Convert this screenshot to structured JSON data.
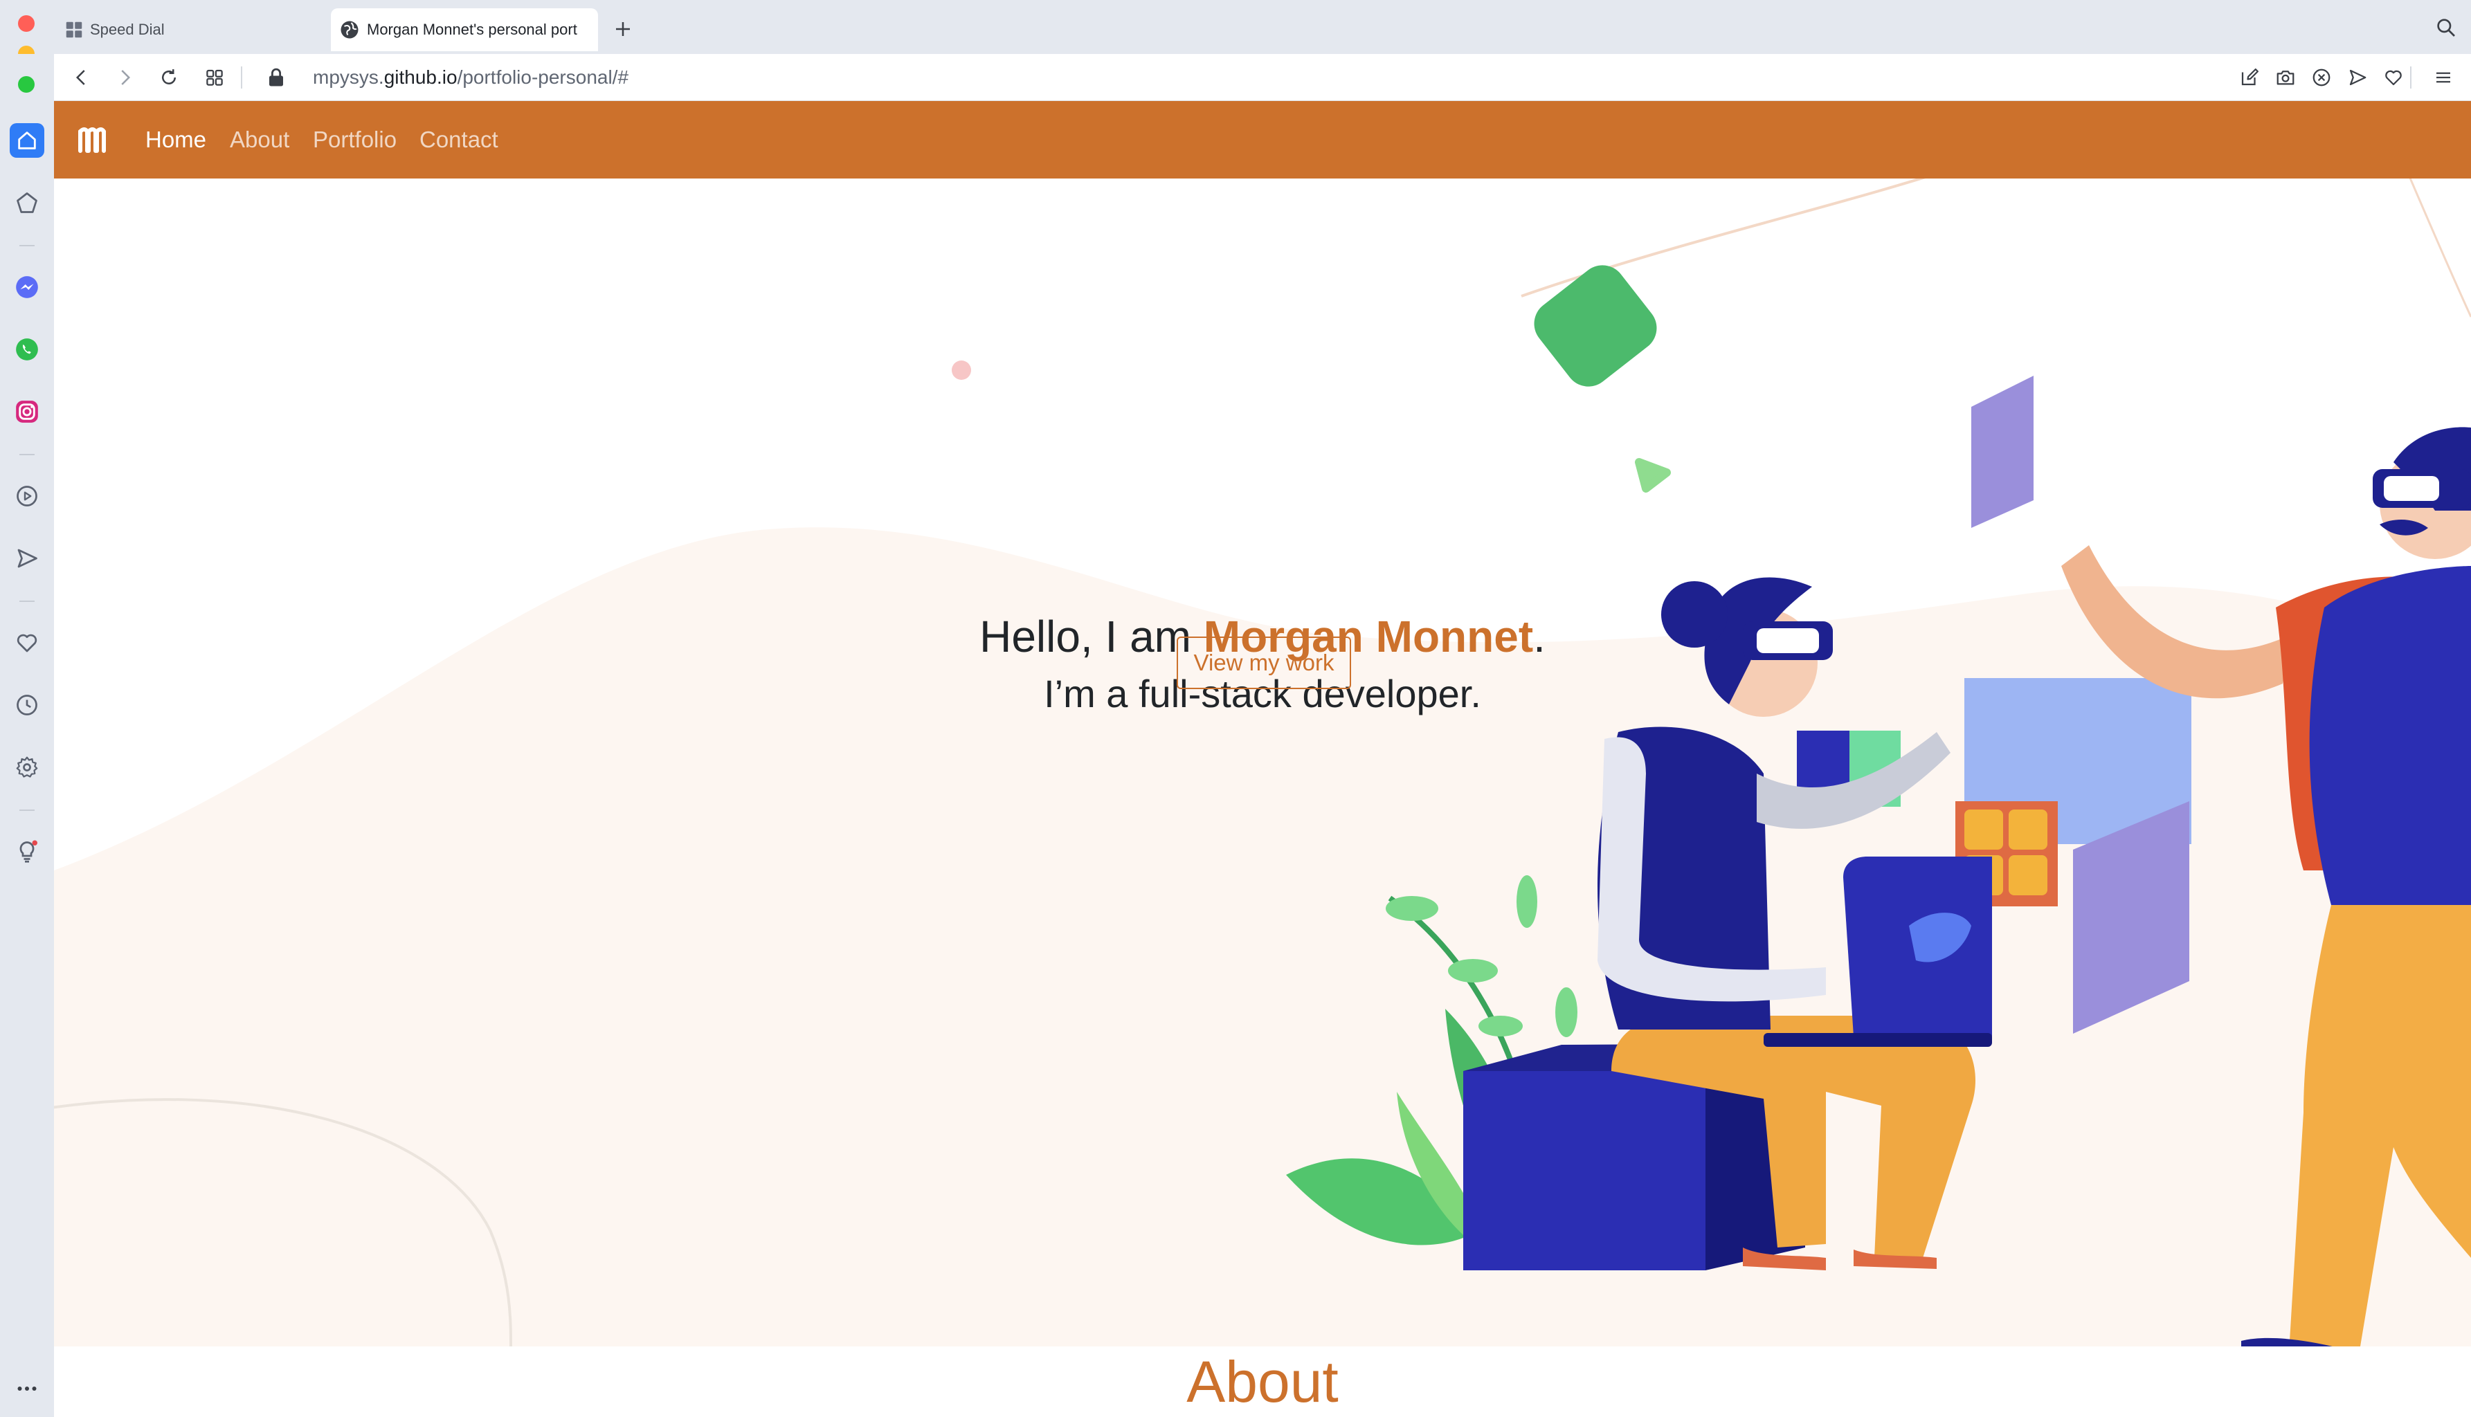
{
  "browser": {
    "tabs": [
      {
        "title": "Speed Dial",
        "active": false
      },
      {
        "title": "Morgan Monnet's personal port",
        "active": true
      }
    ],
    "address": {
      "prefix": "mpysys.",
      "domain": "github.io",
      "path": "/portfolio-personal/#"
    },
    "sidebar_icons": [
      "home-icon",
      "bookmarks-icon",
      "messenger-icon",
      "whatsapp-icon",
      "instagram-icon",
      "player-icon",
      "send-icon",
      "heart-icon",
      "history-icon",
      "settings-icon",
      "bulb-icon",
      "more-icon"
    ],
    "toolbar_icons": [
      "back-icon",
      "forward-icon",
      "reload-icon",
      "grid-icon",
      "lock-icon",
      "edit-icon",
      "camera-icon",
      "adblock-icon",
      "send-icon",
      "heart-icon",
      "menu-icon",
      "search-icon"
    ]
  },
  "site": {
    "nav": {
      "links": [
        {
          "label": "Home",
          "active": true
        },
        {
          "label": "About",
          "active": false
        },
        {
          "label": "Portfolio",
          "active": false
        },
        {
          "label": "Contact",
          "active": false
        }
      ]
    },
    "hero": {
      "greeting": "Hello, I am ",
      "name": "Morgan Monnet",
      "period": ".",
      "subtitle": "I’m a full-stack developer.",
      "cta_label": "View my work"
    },
    "about": {
      "heading": "About"
    }
  },
  "colors": {
    "brand": "#cc712c",
    "browser_chrome": "#e4e8ef",
    "hero_background": "#fdf6f1",
    "text": "#212529"
  }
}
